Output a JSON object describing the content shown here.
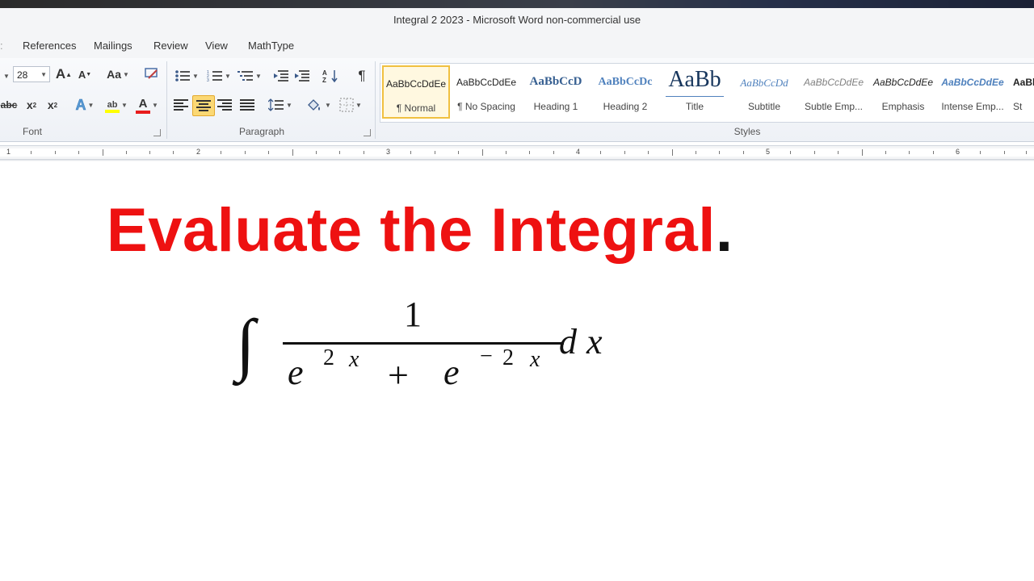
{
  "window": {
    "title": "Integral 2 2023  -  Microsoft Word non-commercial use"
  },
  "tabs": [
    "References",
    "Mailings",
    "Review",
    "View",
    "MathType"
  ],
  "ribbon": {
    "font": {
      "size": "28",
      "group_label": "Font",
      "font_color": "#e81c1c",
      "highlight_color": "#ffff00"
    },
    "paragraph": {
      "group_label": "Paragraph"
    },
    "styles": {
      "group_label": "Styles",
      "items": [
        {
          "sample": "AaBbCcDdEe",
          "name": "¶ Normal"
        },
        {
          "sample": "AaBbCcDdEe",
          "name": "¶ No Spacing"
        },
        {
          "sample": "AaBbCcD",
          "name": "Heading 1"
        },
        {
          "sample": "AaBbCcDc",
          "name": "Heading 2"
        },
        {
          "sample": "AaBb",
          "name": "Title"
        },
        {
          "sample": "AaBbCcDd",
          "name": "Subtitle"
        },
        {
          "sample": "AaBbCcDdEe",
          "name": "Subtle Emp..."
        },
        {
          "sample": "AaBbCcDdEe",
          "name": "Emphasis"
        },
        {
          "sample": "AaBbCcDdEe",
          "name": "Intense Emp..."
        },
        {
          "sample": "AaBb",
          "name": "St"
        }
      ]
    }
  },
  "ruler": {
    "numbers": [
      "1",
      "2",
      "3",
      "4",
      "5",
      "6"
    ]
  },
  "document": {
    "title": "Evaluate the Integral",
    "title_period": ".",
    "title_color": "#ee1111",
    "equation": {
      "integral_sign": "∫",
      "numerator": "1",
      "term1_base": "e",
      "term1_exp_num": "2",
      "term1_exp_var": "x",
      "plus": "+",
      "term2_base": "e",
      "term2_exp_sign": "−",
      "term2_exp_num": "2",
      "term2_exp_var": "x",
      "d": "d",
      "var": "x"
    }
  }
}
